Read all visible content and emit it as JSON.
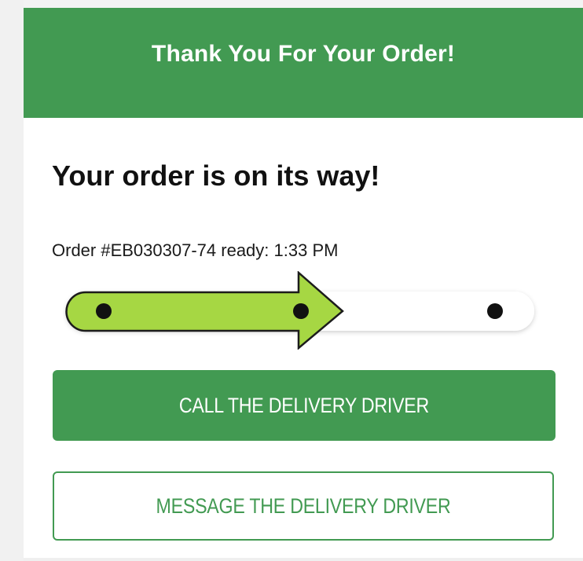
{
  "header": {
    "title": "Thank You For Your Order!"
  },
  "status": {
    "heading": "Your order is on its way!",
    "order_line": "Order #EB030307-74 ready: 1:33 PM"
  },
  "tracker": {
    "stages_total": 3,
    "current_stage": 2,
    "progress_fill_color": "#a6d743",
    "track_color": "#ffffff"
  },
  "actions": {
    "call_label": "CALL THE DELIVERY DRIVER",
    "message_label": "MESSAGE THE DELIVERY DRIVER"
  },
  "colors": {
    "brand_green": "#429a52",
    "arrow_green": "#a6d743"
  }
}
